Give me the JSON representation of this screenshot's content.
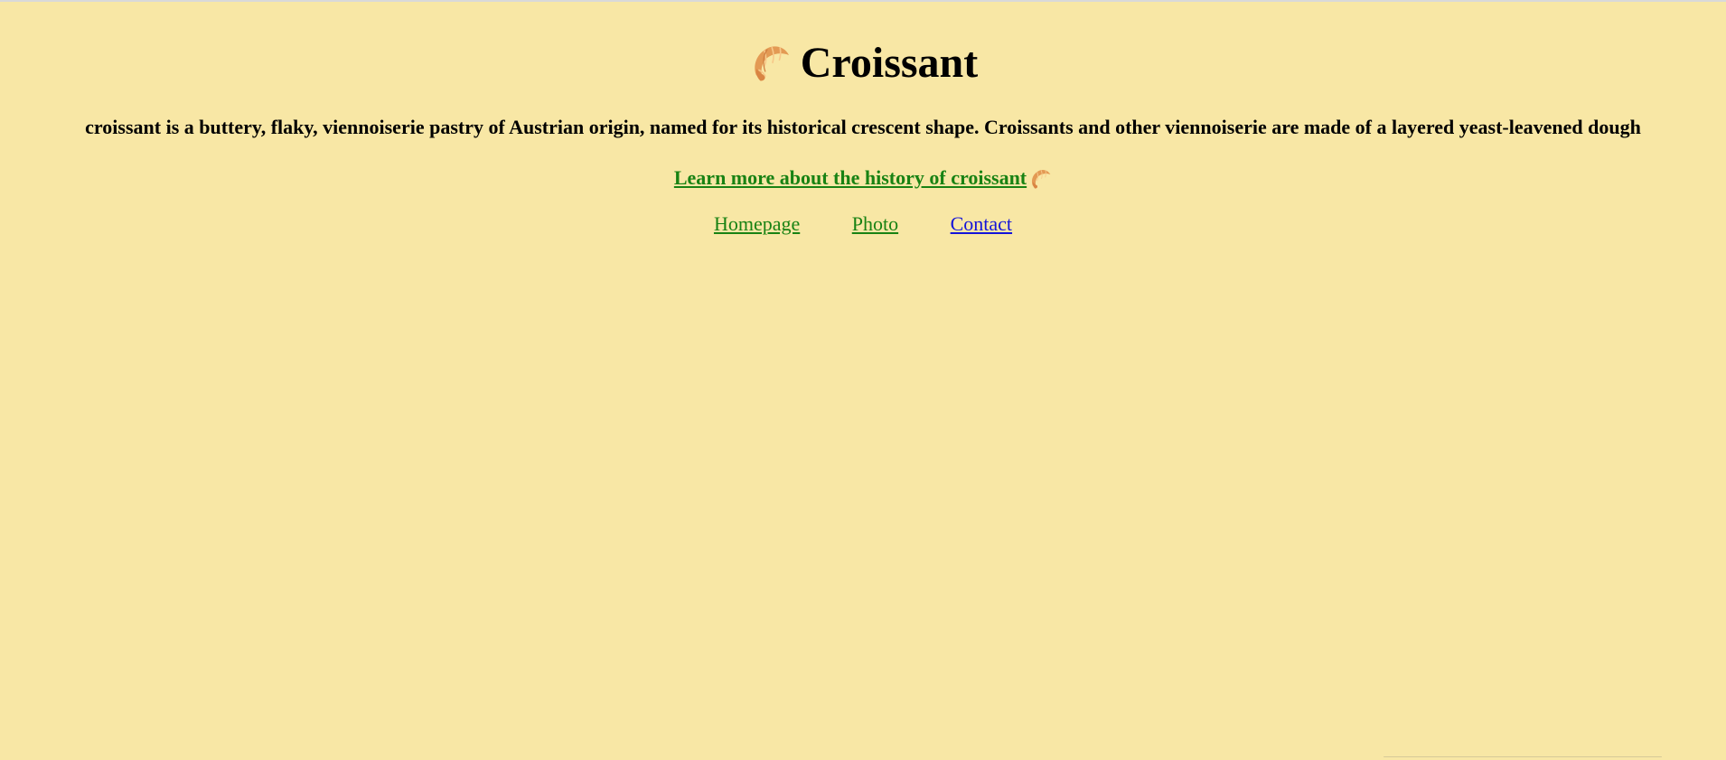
{
  "page": {
    "title": "Croissant",
    "title_icon": "croissant-icon",
    "intro": "croissant is a buttery, flaky, viennoiserie pastry of Austrian origin, named for its historical crescent shape. Croissants and other viennoiserie are made of a layered yeast-leavened dough",
    "history_link": "Learn more about the history of croissant",
    "history_icon": "croissant-icon"
  },
  "nav": {
    "items": [
      {
        "label": "Homepage",
        "color": "#188213"
      },
      {
        "label": "Photo",
        "color": "#188213"
      },
      {
        "label": "Contact",
        "color": "#1414d9"
      }
    ]
  },
  "colors": {
    "background": "#f8e7a5",
    "link_green": "#188213",
    "link_blue": "#1414d9",
    "text": "#000000"
  }
}
